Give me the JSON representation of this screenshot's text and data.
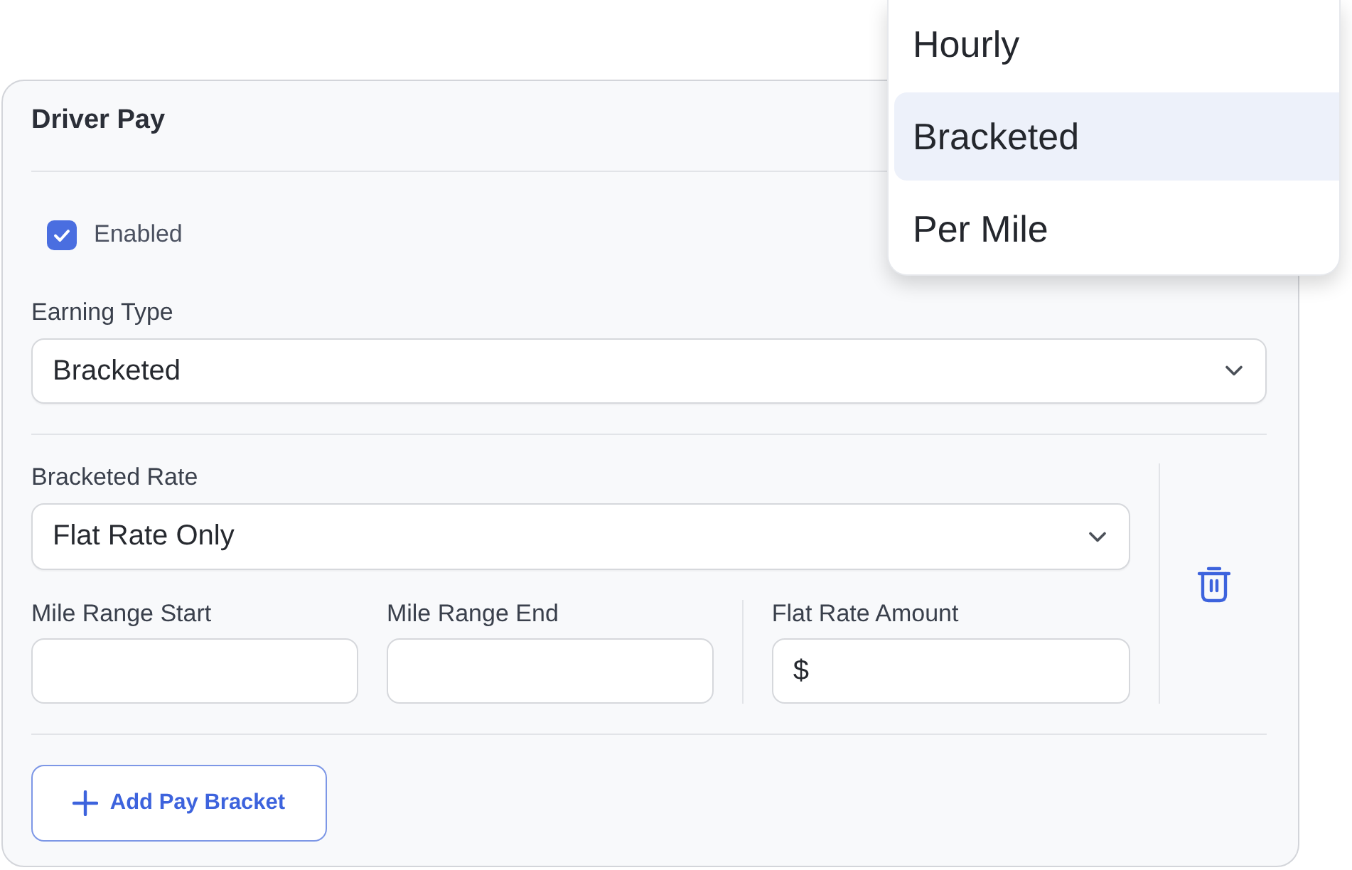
{
  "card": {
    "title": "Driver Pay"
  },
  "enabled": {
    "label": "Enabled",
    "checked": true
  },
  "earning_type": {
    "label": "Earning Type",
    "value": "Bracketed"
  },
  "brackets": [
    {
      "rate": {
        "label": "Bracketed Rate",
        "value": "Flat Rate Only"
      },
      "fields": [
        {
          "kind": "range",
          "label": "Mile Range Start"
        },
        {
          "kind": "range",
          "label": "Mile Range End"
        },
        {
          "kind": "amount",
          "label": "Flat Rate Amount",
          "prefix": "$"
        }
      ]
    }
  ],
  "add_button": {
    "label": "Add Pay Bracket"
  },
  "dropdown_menu": {
    "options": [
      {
        "label": "Hourly",
        "selected": false
      },
      {
        "label": "Bracketed",
        "selected": true
      },
      {
        "label": "Per Mile",
        "selected": false
      }
    ]
  }
}
